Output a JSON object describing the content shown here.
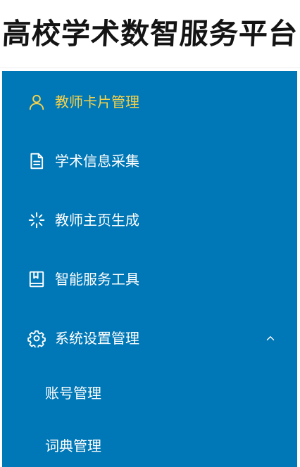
{
  "header": {
    "title": "高校学术数智服务平台"
  },
  "sidebar": {
    "items": [
      {
        "label": "教师卡片管理",
        "icon": "user-icon",
        "active": true
      },
      {
        "label": "学术信息采集",
        "icon": "document-icon",
        "active": false
      },
      {
        "label": "教师主页生成",
        "icon": "loading-icon",
        "active": false
      },
      {
        "label": "智能服务工具",
        "icon": "book-icon",
        "active": false
      },
      {
        "label": "系统设置管理",
        "icon": "gear-icon",
        "active": false,
        "expanded": true
      }
    ],
    "subitems": [
      {
        "label": "账号管理"
      },
      {
        "label": "词典管理"
      }
    ]
  },
  "colors": {
    "sidebar_bg": "#0077b6",
    "active_text": "#f5d24c",
    "text": "#ffffff"
  }
}
